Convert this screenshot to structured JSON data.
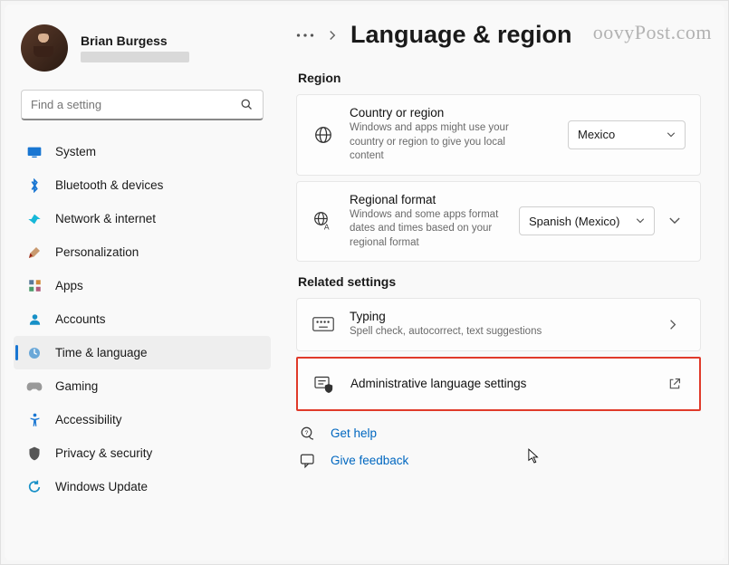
{
  "profile": {
    "name": "Brian Burgess"
  },
  "search": {
    "placeholder": "Find a setting"
  },
  "sidebar": {
    "items": [
      {
        "label": "System",
        "icon": "system-icon",
        "color": "#1976d2"
      },
      {
        "label": "Bluetooth & devices",
        "icon": "bluetooth-icon",
        "color": "#1976d2"
      },
      {
        "label": "Network & internet",
        "icon": "network-icon",
        "color": "#17a2b8"
      },
      {
        "label": "Personalization",
        "icon": "personalization-icon",
        "color": "#9a2417"
      },
      {
        "label": "Apps",
        "icon": "apps-icon",
        "color": "#555"
      },
      {
        "label": "Accounts",
        "icon": "accounts-icon",
        "color": "#1790c7"
      },
      {
        "label": "Time & language",
        "icon": "time-language-icon",
        "color": "#3a6b9a",
        "active": true
      },
      {
        "label": "Gaming",
        "icon": "gaming-icon",
        "color": "#777"
      },
      {
        "label": "Accessibility",
        "icon": "accessibility-icon",
        "color": "#1976d2"
      },
      {
        "label": "Privacy & security",
        "icon": "privacy-icon",
        "color": "#444"
      },
      {
        "label": "Windows Update",
        "icon": "update-icon",
        "color": "#1790c7"
      }
    ]
  },
  "breadcrumb": {
    "dots": "…",
    "title": "Language & region"
  },
  "sections": {
    "region": {
      "header": "Region",
      "country": {
        "title": "Country or region",
        "sub": "Windows and apps might use your country or region to give you local content",
        "value": "Mexico"
      },
      "format": {
        "title": "Regional format",
        "sub": "Windows and some apps format dates and times based on your regional format",
        "value": "Spanish (Mexico)"
      }
    },
    "related": {
      "header": "Related settings",
      "typing": {
        "title": "Typing",
        "sub": "Spell check, autocorrect, text suggestions"
      },
      "admin": {
        "title": "Administrative language settings"
      }
    },
    "links": {
      "help": "Get help",
      "feedback": "Give feedback"
    }
  },
  "watermark": "oovyPost.com"
}
